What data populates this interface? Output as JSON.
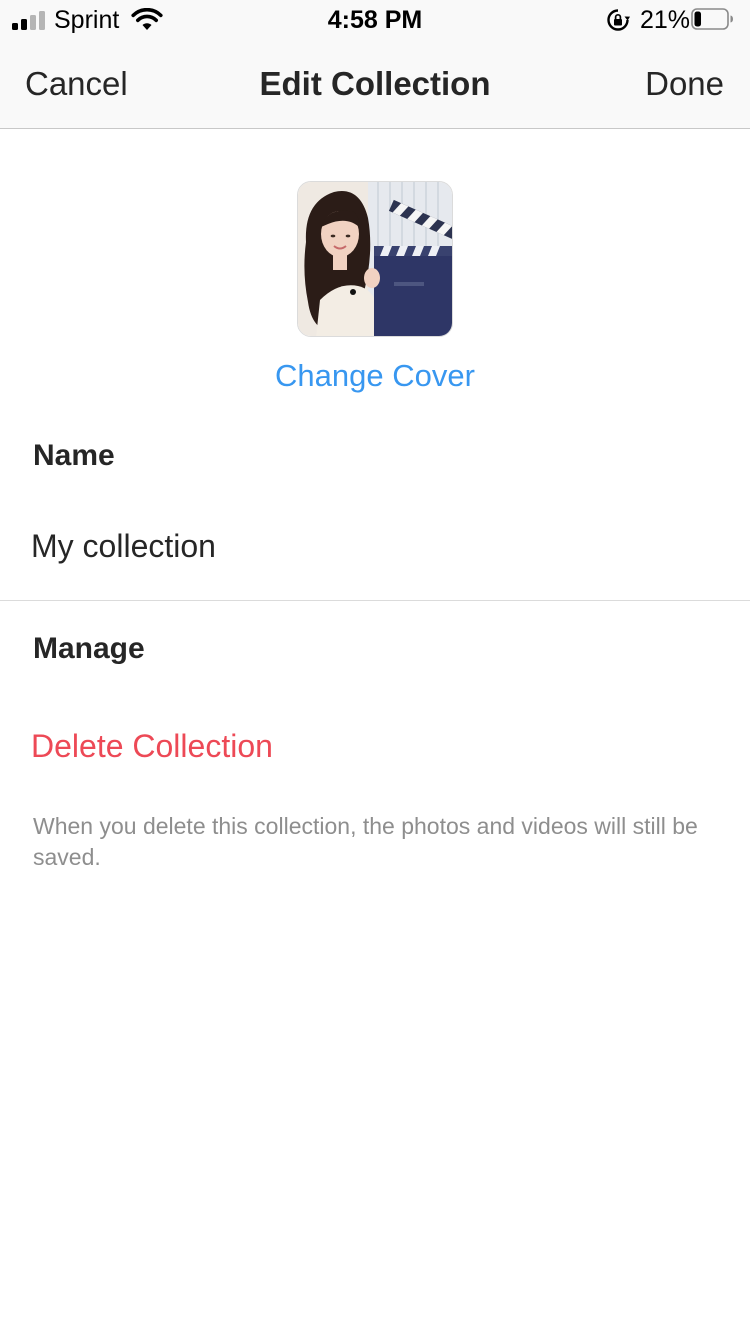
{
  "status_bar": {
    "carrier": "Sprint",
    "time": "4:58 PM",
    "battery_percent": "21%",
    "signal_bars_filled": 2,
    "signal_bars_total": 4,
    "battery_level": 0.21,
    "icons": [
      "signal-icon",
      "wifi-icon",
      "orientation-lock-icon",
      "battery-icon"
    ]
  },
  "nav": {
    "cancel_label": "Cancel",
    "title": "Edit Collection",
    "done_label": "Done"
  },
  "cover": {
    "change_label": "Change Cover"
  },
  "name_section": {
    "label": "Name",
    "value": "My collection"
  },
  "manage_section": {
    "label": "Manage",
    "delete_label": "Delete Collection",
    "note": "When you delete this collection, the photos and videos will still be saved."
  },
  "colors": {
    "link_blue": "#3897f0",
    "destructive_red": "#ed4956",
    "text": "#262626",
    "secondary_text": "#8e8e8e",
    "bar_background": "#f9f9f9"
  }
}
